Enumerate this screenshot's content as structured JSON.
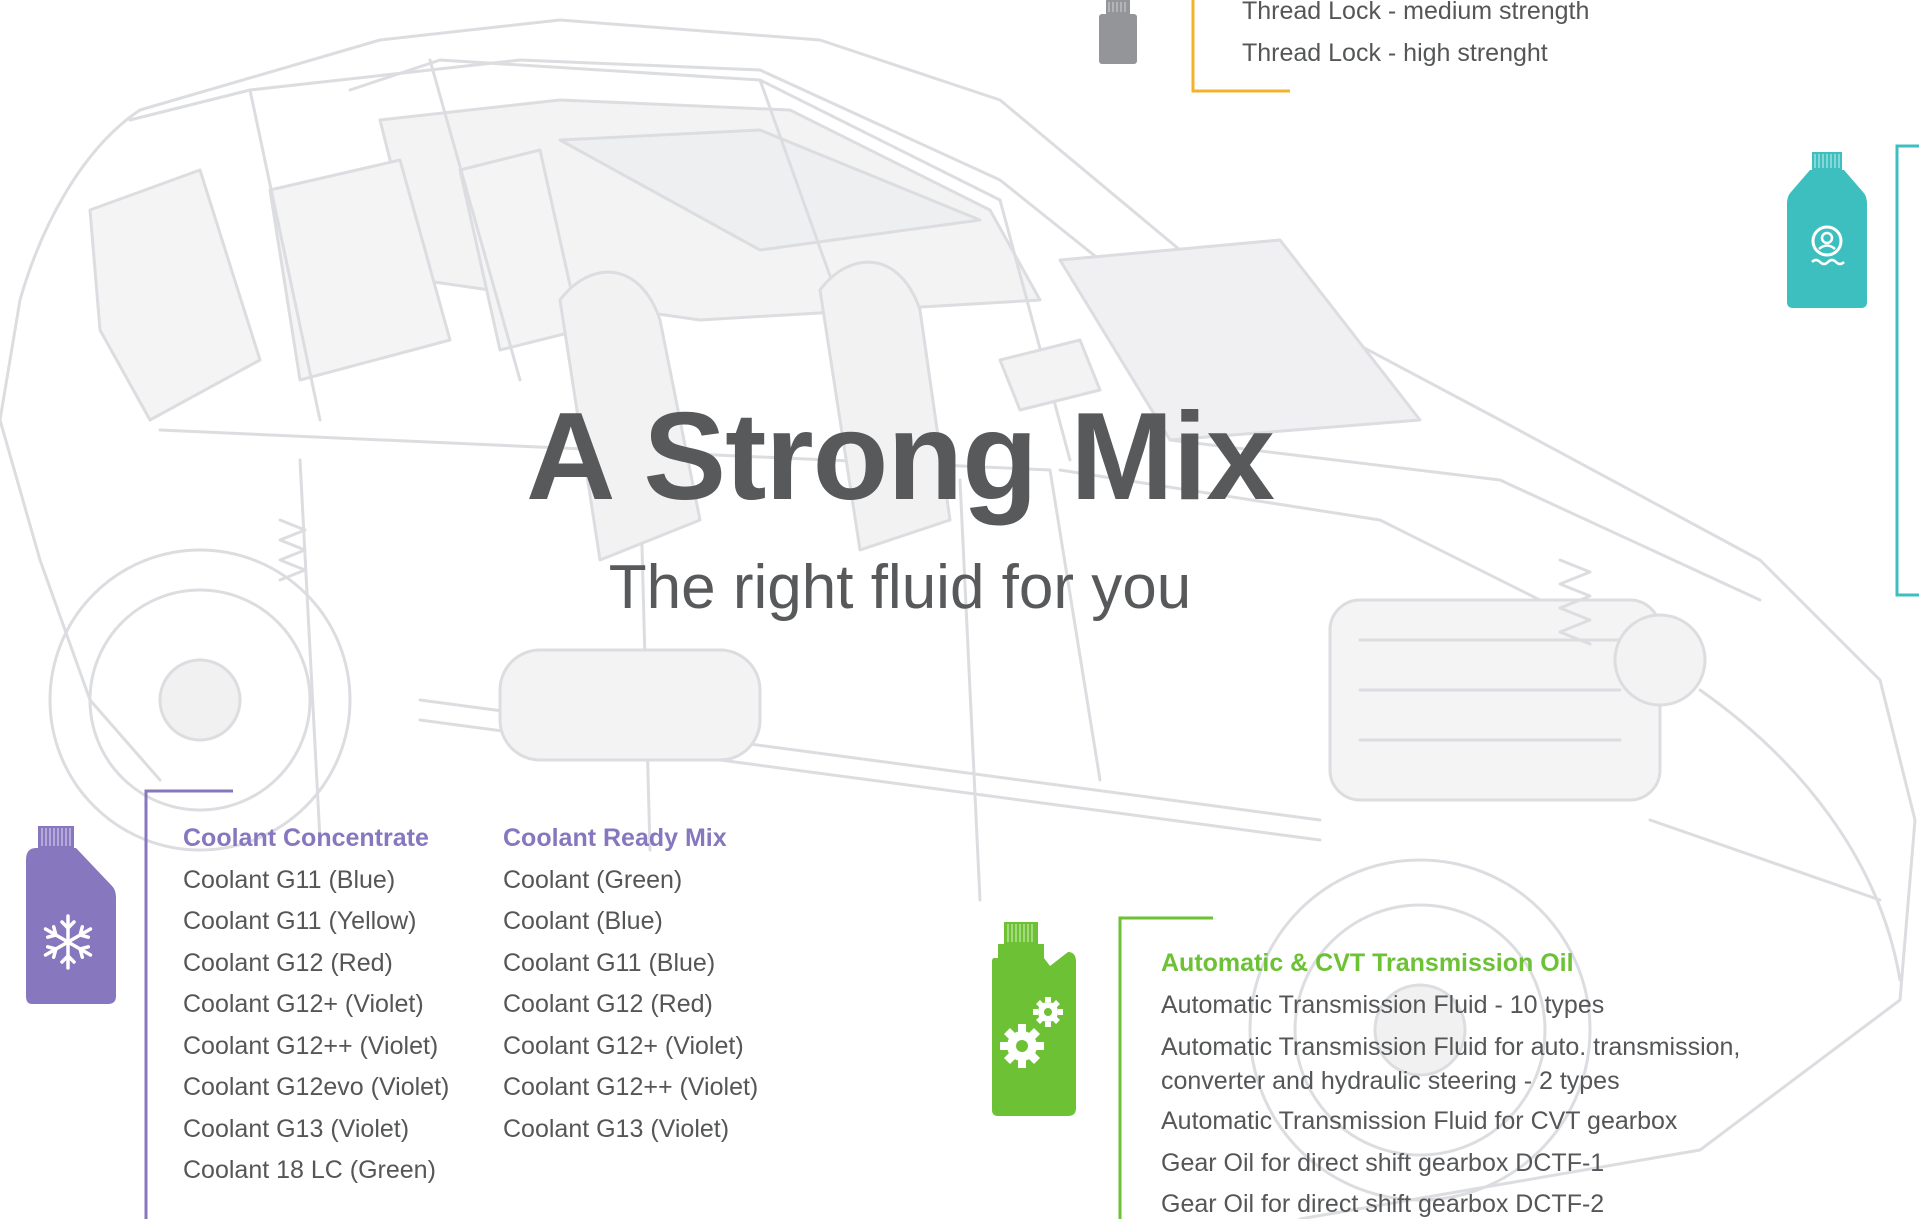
{
  "hero": {
    "title": "A Strong Mix",
    "subtitle": "The right fluid for you"
  },
  "colors": {
    "text": "#58595b",
    "coolant_accent": "#8677be",
    "transmission_accent": "#6cc135",
    "washer_accent": "#3ebfbf",
    "threadlock_accent": "#f2b32c",
    "threadlock_bottle": "#939598"
  },
  "thread_lock": {
    "items": [
      "Thread Lock - medium strength",
      "Thread Lock - high strenght"
    ]
  },
  "coolant_concentrate": {
    "heading": "Coolant Concentrate",
    "items": [
      "Coolant G11 (Blue)",
      "Coolant G11 (Yellow)",
      "Coolant G12 (Red)",
      "Coolant G12+ (Violet)",
      "Coolant G12++ (Violet)",
      "Coolant G12evo (Violet)",
      "Coolant G13 (Violet)",
      "Coolant 18 LC (Green)"
    ]
  },
  "coolant_ready_mix": {
    "heading": "Coolant Ready Mix",
    "items": [
      "Coolant (Green)",
      "Coolant (Blue)",
      "Coolant G11 (Blue)",
      "Coolant G12 (Red)",
      "Coolant G12+ (Violet)",
      "Coolant G12++ (Violet)",
      "Coolant G13 (Violet)"
    ]
  },
  "transmission": {
    "heading": "Automatic & CVT Transmission Oil",
    "items": [
      "Automatic Transmission Fluid - 10 types",
      "Automatic Transmission Fluid for auto. transmission, converter and hydraulic steering - 2 types",
      "Automatic Transmission Fluid for CVT gearbox",
      "Gear Oil for direct shift gearbox DCTF-1",
      "Gear Oil for direct shift gearbox DCTF-2"
    ]
  },
  "icons": {
    "coolant": "snowflake-icon",
    "transmission": "gears-icon",
    "washer": "windshield-washer-icon",
    "threadlock": "thread-lock-bottle-icon",
    "background": "transparent-car-illustration"
  }
}
